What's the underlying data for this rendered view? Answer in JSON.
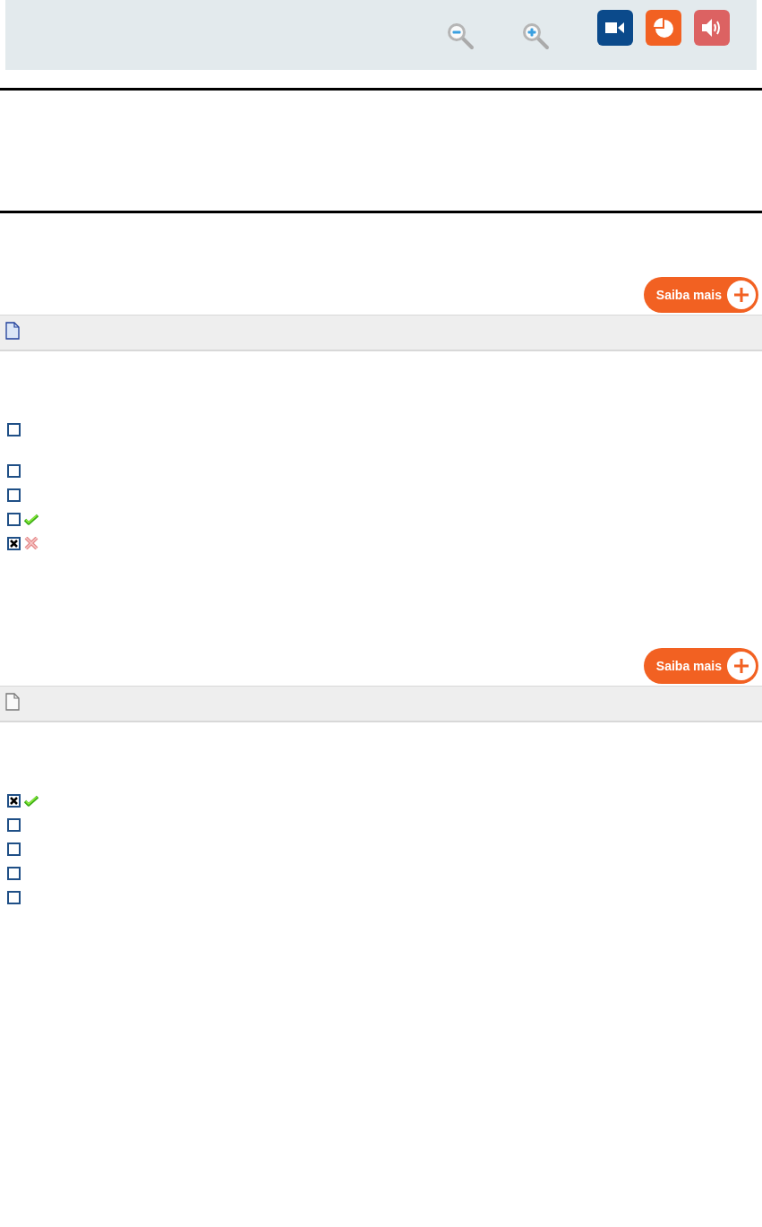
{
  "toolbar": {
    "media_buttons": [
      {
        "kind": "video",
        "color": "#0b4a8b"
      },
      {
        "kind": "chart",
        "color": "#f26122"
      },
      {
        "kind": "audio",
        "color": "#dc6262"
      }
    ]
  },
  "questions": [
    {
      "more_button": "Saiba mais",
      "document_tinted": true,
      "options": [
        {
          "checked": false,
          "kind": "plain"
        },
        {
          "checked": false,
          "kind": "plain"
        },
        {
          "checked": false,
          "kind": "plain"
        },
        {
          "checked": false,
          "kind": "correct"
        },
        {
          "checked": true,
          "kind": "wrong"
        }
      ]
    },
    {
      "more_button": "Saiba mais",
      "document_tinted": false,
      "options": [
        {
          "checked": true,
          "kind": "correct"
        },
        {
          "checked": false,
          "kind": "plain"
        },
        {
          "checked": false,
          "kind": "plain"
        },
        {
          "checked": false,
          "kind": "plain"
        },
        {
          "checked": false,
          "kind": "plain"
        }
      ]
    }
  ]
}
